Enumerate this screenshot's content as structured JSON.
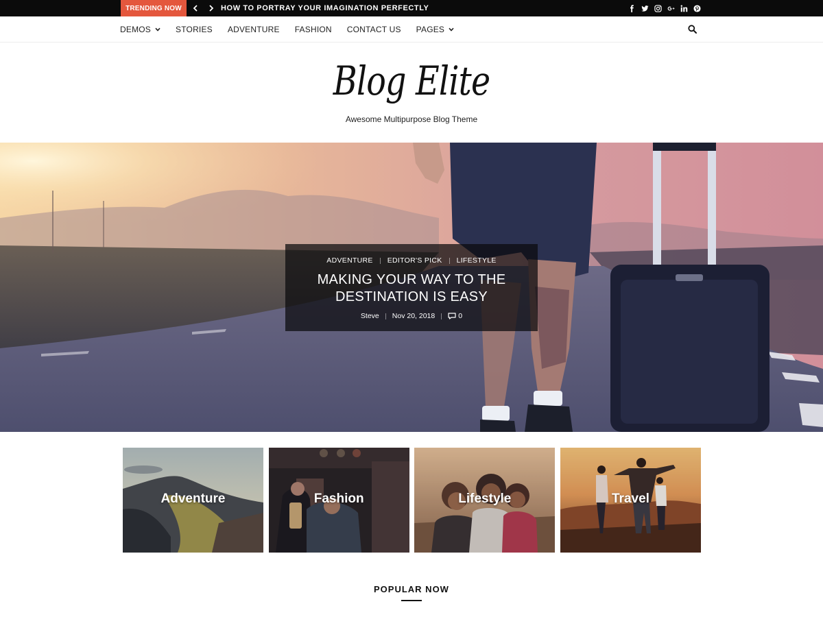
{
  "topbar": {
    "trending_label": "TRENDING NOW",
    "trending_title": "HOW TO PORTRAY YOUR IMAGINATION PERFECTLY",
    "social_icons": [
      "facebook-icon",
      "twitter-icon",
      "instagram-icon",
      "google-plus-icon",
      "linkedin-icon",
      "pinterest-icon"
    ]
  },
  "nav": {
    "items": [
      {
        "label": "DEMOS",
        "has_dropdown": true
      },
      {
        "label": "STORIES",
        "has_dropdown": false
      },
      {
        "label": "ADVENTURE",
        "has_dropdown": false
      },
      {
        "label": "FASHION",
        "has_dropdown": false
      },
      {
        "label": "CONTACT US",
        "has_dropdown": false
      },
      {
        "label": "PAGES",
        "has_dropdown": true
      }
    ],
    "search_icon": "search-icon"
  },
  "brand": {
    "logo": "Blog Elite",
    "tagline": "Awesome Multipurpose Blog Theme"
  },
  "hero": {
    "categories": [
      "ADVENTURE",
      "EDITOR'S PICK",
      "LIFESTYLE"
    ],
    "title": "MAKING YOUR WAY TO THE DESTINATION IS EASY",
    "author": "Steve",
    "date": "Nov 20, 2018",
    "comments": "0"
  },
  "tiles": [
    {
      "label": "Adventure"
    },
    {
      "label": "Fashion"
    },
    {
      "label": "Lifestyle"
    },
    {
      "label": "Travel"
    }
  ],
  "popular": {
    "heading": "POPULAR NOW"
  },
  "colors": {
    "accent": "#e4573d",
    "topbar": "#0b0b0b",
    "text": "#111111"
  }
}
